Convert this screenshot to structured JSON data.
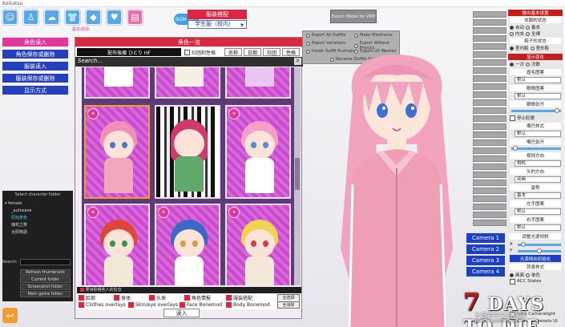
{
  "window": {
    "title": "Koikatsu"
  },
  "toolbar": {
    "gbtn_label": "BGM OFF",
    "set_label": "設定/追加"
  },
  "coordinate": {
    "title": "服装搭配",
    "selected": "学生服（校内）"
  },
  "left_menu": {
    "items": [
      {
        "label": "角色读入",
        "style": "pink"
      },
      {
        "label": "角色保存或删除",
        "style": "blue"
      },
      {
        "label": "服装读入",
        "style": "blue"
      },
      {
        "label": "服装保存或删除",
        "style": "blue"
      },
      {
        "label": "显示方式",
        "style": "blue"
      }
    ]
  },
  "folder_panel": {
    "title": "Select character folder",
    "tree": [
      "▾ female",
      "_autosave",
      "原始角色",
      "魂花之笑",
      "太阳物語"
    ],
    "search_label": "Search:",
    "buttons": [
      "Refresh thumbnails",
      "Current folder",
      "Screenshot folder",
      "Main game folder"
    ]
  },
  "dialog": {
    "title": "角色一览",
    "filter_text": "配布後藤 ひとり HF",
    "club_label": "社团和性格",
    "sort_buttons": [
      "名称",
      "日期",
      "社团",
      "性格"
    ],
    "search_placeholder": "Search...",
    "close": "X",
    "options_header": "要读取哪些人的信息",
    "options_row1": [
      "脸部",
      "身体",
      "头发",
      "角色情报",
      "服装搭配"
    ],
    "options_row2": [
      "Clothes overlays",
      "Skin/eye overlays",
      "Face Bonemod",
      "Body Bonemod"
    ],
    "select_all": "全选择",
    "deselect_all": "全消除",
    "load_button": "读入"
  },
  "float_panel": {
    "items": [
      "Export All Outfits",
      "Make Wireframe",
      "Export Variations",
      "Export Without Physics",
      "Inside Outfit Pushups",
      "Export UV Meshes",
      "Rename Outfits Folder"
    ]
  },
  "export_button": "Export Model for VRM",
  "right_panel": {
    "header1": "输出基本设置",
    "clothes_state": "衣服的状态",
    "state_opts": [
      "自动",
      "着衣",
      "内衣",
      "全裸"
    ],
    "shoes_state": "鞋子的状态",
    "shoe_opts": [
      "室内鞋",
      "室外鞋"
    ],
    "header2": "显示变化",
    "show_opts": [
      "一次",
      "次数"
    ],
    "eyebrow_label": "眉毛图案",
    "eyebrow_value": "默认",
    "eye_label": "眼睛图案",
    "eye_value": "默认",
    "eye_open": "眼睛张开",
    "blink": "停止眨眼",
    "mouth_label": "嘴巴样式",
    "mouth_value": "默认",
    "mouth_open": "嘴巴张开",
    "gaze_label": "视线方向",
    "gaze_value": "相机",
    "head_label": "头的方向",
    "head_value": "动画",
    "pose_label": "姿势",
    "pose_value": "基本",
    "hand_l": "左手图案",
    "hand_l_value": "默认",
    "hand_r": "右手图案",
    "hand_r_value": "默认",
    "light_label": "调整光源倾斜",
    "light_x": "X",
    "light_y": "Y",
    "light_reset": "光源倾向初始化",
    "bg_label": "背景样式",
    "bg_opts": [
      "画面",
      "单色"
    ],
    "acc_states": "ACC States",
    "extra": [
      "Lock Cameralight",
      "Camera Presets UI"
    ]
  },
  "cameras": [
    "Camera 1",
    "Camera 2",
    "Camera 3",
    "Camera 4"
  ],
  "watermark": {
    "title": "DAYS TO DIE",
    "seven": "7",
    "sub": "七日杀中文资源网",
    "url": "www.7daystodie.com.cn"
  },
  "colors": {
    "accent_red": "#d9283f",
    "accent_blue": "#263fbd",
    "accent_pink": "#e2359d"
  }
}
